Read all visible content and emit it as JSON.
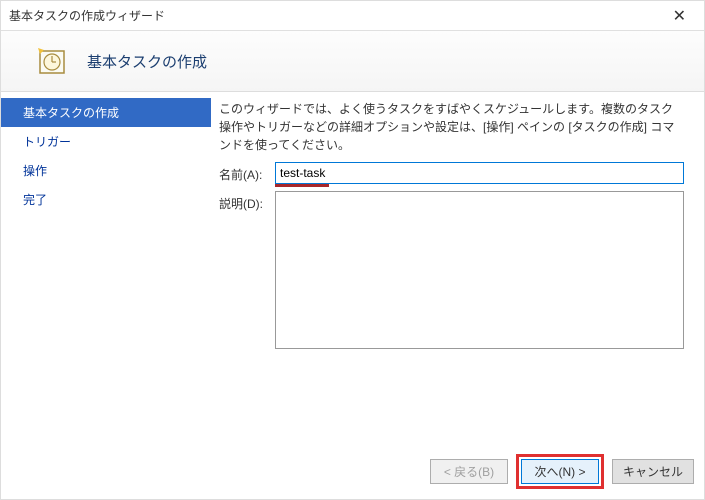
{
  "window": {
    "title": "基本タスクの作成ウィザード"
  },
  "header": {
    "title": "基本タスクの作成"
  },
  "sidebar": {
    "items": [
      {
        "label": "基本タスクの作成"
      },
      {
        "label": "トリガー"
      },
      {
        "label": "操作"
      },
      {
        "label": "完了"
      }
    ]
  },
  "main": {
    "instructions": "このウィザードでは、よく使うタスクをすばやくスケジュールします。複数のタスク操作やトリガーなどの詳細オプションや設定は、[操作] ペインの [タスクの作成] コマンドを使ってください。",
    "name_label": "名前(A):",
    "name_value": "test-task",
    "desc_label": "説明(D):",
    "desc_value": ""
  },
  "buttons": {
    "back": "< 戻る(B)",
    "next": "次へ(N) >",
    "cancel": "キャンセル"
  }
}
